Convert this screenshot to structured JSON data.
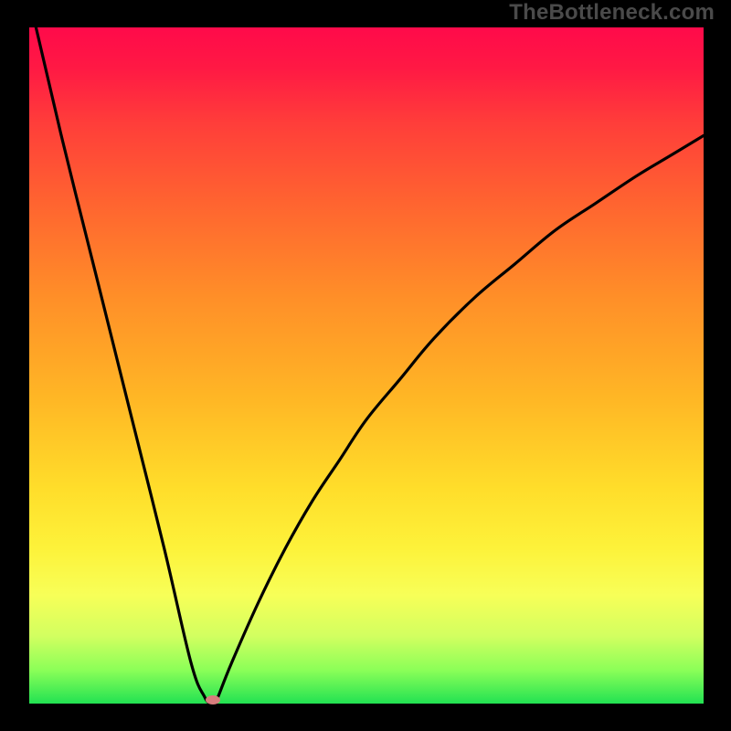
{
  "watermark": "TheBottleneck.com",
  "chart_data": {
    "type": "line",
    "title": "",
    "xlabel": "",
    "ylabel": "",
    "xlim": [
      0,
      100
    ],
    "ylim": [
      0,
      100
    ],
    "series": [
      {
        "name": "bottleneck-curve",
        "x": [
          1,
          5,
          10,
          15,
          20,
          24,
          26,
          27,
          27.5,
          28,
          30,
          34,
          38,
          42,
          46,
          50,
          55,
          60,
          66,
          72,
          78,
          84,
          90,
          95,
          100
        ],
        "values": [
          100,
          83,
          63,
          43,
          23,
          6,
          1,
          0,
          0,
          1,
          6,
          15,
          23,
          30,
          36,
          42,
          48,
          54,
          60,
          65,
          70,
          74,
          78,
          81,
          84
        ]
      }
    ],
    "minimum_marker": {
      "x": 27.2,
      "y": 0.5
    },
    "grid": false,
    "legend": false,
    "background_gradient": [
      "#ff0a4a",
      "#ff3d3a",
      "#ff8f28",
      "#ffdd2a",
      "#f7ff58",
      "#22e252"
    ]
  }
}
